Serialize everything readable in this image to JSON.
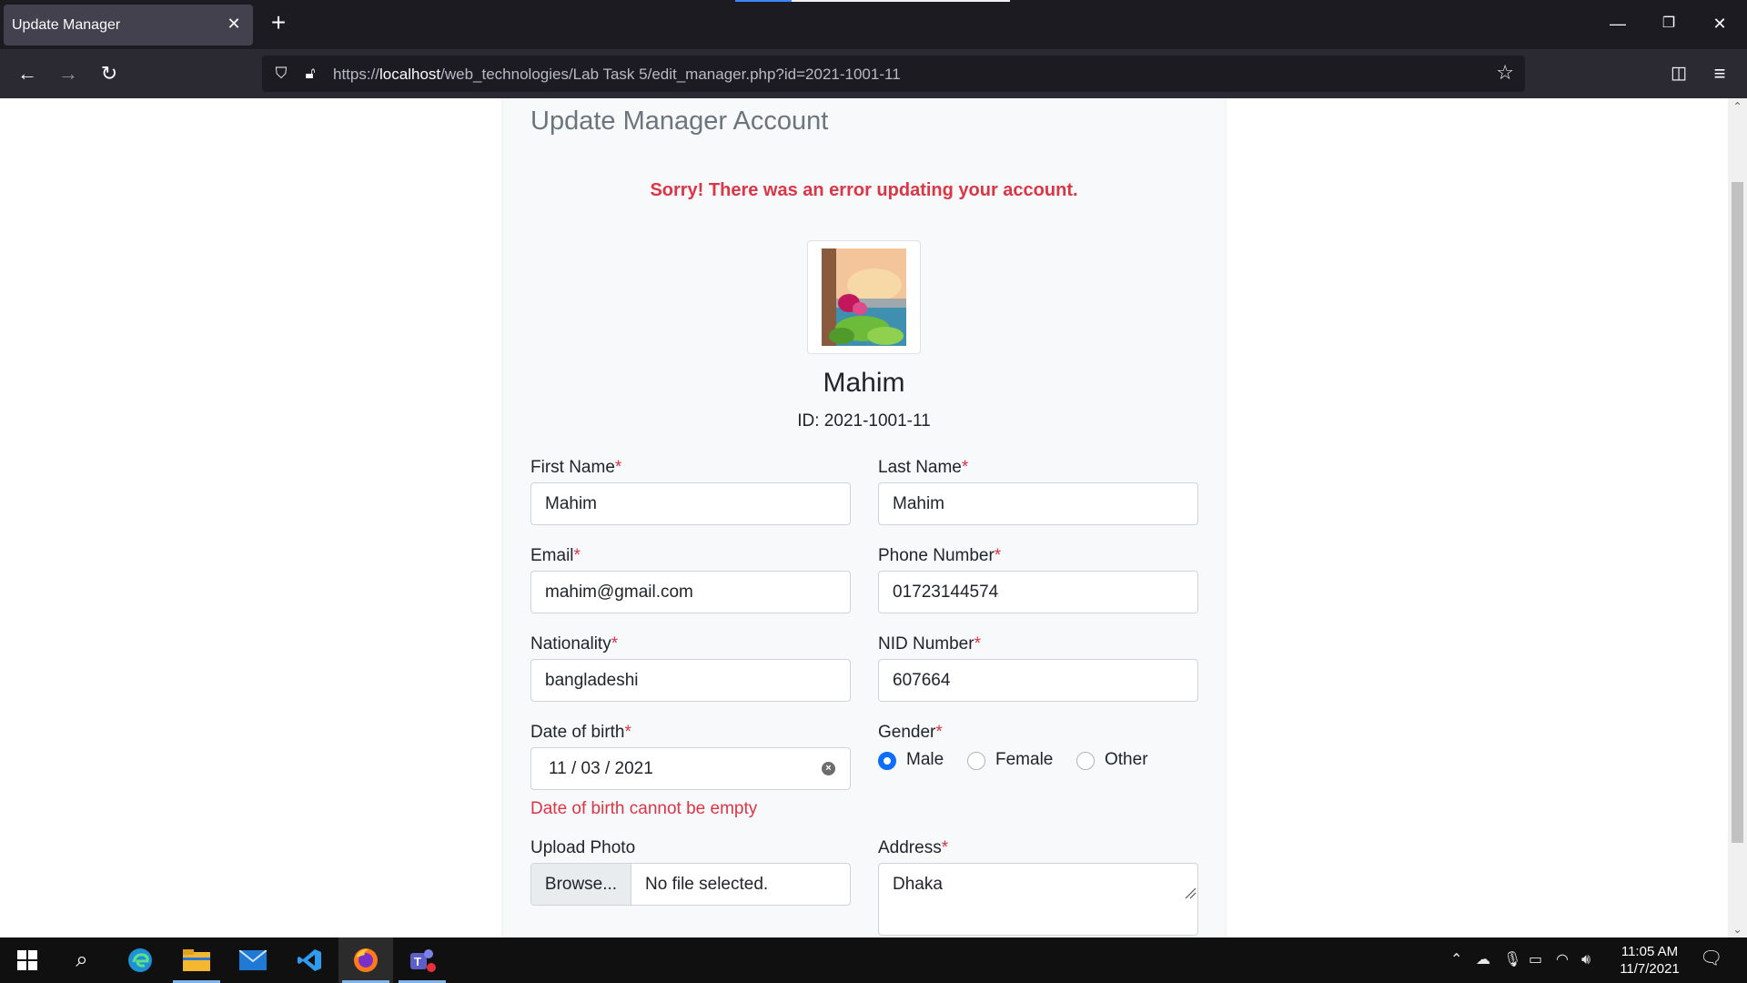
{
  "browser": {
    "tab_title": "Update Manager",
    "url_prefix": "https://",
    "url_host": "localhost",
    "url_path": "/web_technologies/Lab Task 5/edit_manager.php?id=2021-1001-11"
  },
  "page": {
    "title": "Update Manager Account",
    "error_message": "Sorry! There was an error updating your account.",
    "profile": {
      "name": "Mahim",
      "id_text": "ID: 2021-1001-11"
    },
    "required_mark": "*",
    "form": {
      "first_name": {
        "label": "First Name",
        "value": "Mahim"
      },
      "last_name": {
        "label": "Last Name",
        "value": "Mahim"
      },
      "email": {
        "label": "Email",
        "value": "mahim@gmail.com"
      },
      "phone": {
        "label": "Phone Number",
        "value": "01723144574"
      },
      "nationality": {
        "label": "Nationality",
        "value": "bangladeshi"
      },
      "nid": {
        "label": "NID Number",
        "value": "607664"
      },
      "dob": {
        "label": "Date of birth",
        "value": "11 / 03 / 2021",
        "error": "Date of birth cannot be empty"
      },
      "gender": {
        "label": "Gender",
        "options": [
          "Male",
          "Female",
          "Other"
        ],
        "selected": "Male"
      },
      "photo": {
        "label": "Upload Photo",
        "browse_label": "Browse...",
        "file_status": "No file selected."
      },
      "address": {
        "label": "Address",
        "value": "Dhaka"
      }
    }
  },
  "taskbar": {
    "time": "11:05 AM",
    "date": "11/7/2021"
  },
  "colors": {
    "error": "#dc3545",
    "accent": "#0d6efd",
    "chrome_bg": "#1c1b22"
  }
}
